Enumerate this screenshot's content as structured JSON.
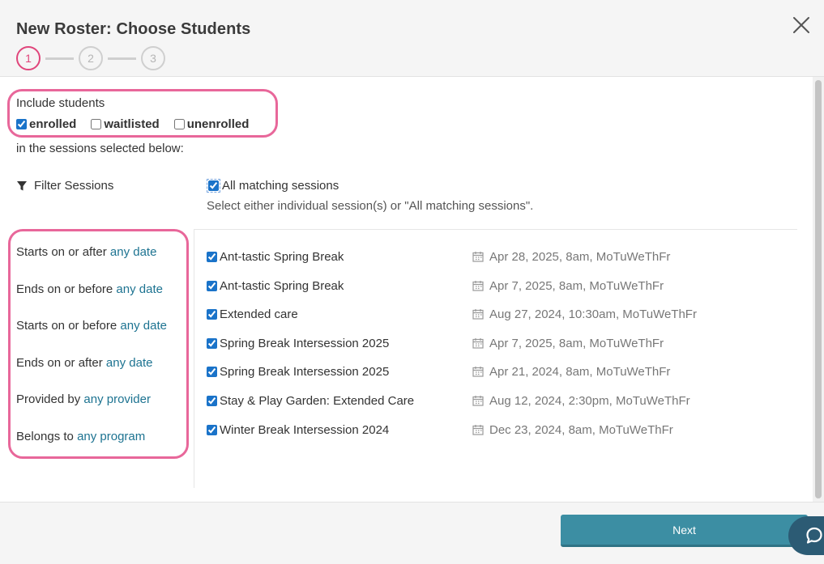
{
  "header": {
    "title": "New Roster: Choose Students",
    "steps": [
      "1",
      "2",
      "3"
    ]
  },
  "include": {
    "label": "Include students",
    "options": [
      {
        "label": "enrolled",
        "checked": true
      },
      {
        "label": "waitlisted",
        "checked": false
      },
      {
        "label": "unenrolled",
        "checked": false
      }
    ],
    "suffix": "in the sessions selected below:"
  },
  "filters": {
    "title": "Filter Sessions",
    "items": [
      {
        "prefix": "Starts on or after ",
        "link": "any date"
      },
      {
        "prefix": "Ends on or before ",
        "link": "any date"
      },
      {
        "prefix": "Starts on or before ",
        "link": "any date"
      },
      {
        "prefix": "Ends on or after ",
        "link": "any date"
      },
      {
        "prefix": "Provided by ",
        "link": "any provider"
      },
      {
        "prefix": "Belongs to ",
        "link": "any program"
      }
    ]
  },
  "sessions_panel": {
    "all_label": "All matching sessions",
    "hint": "Select either individual session(s) or \"All matching sessions\".",
    "items": [
      {
        "name": "Ant-tastic Spring Break",
        "date": "Apr 28, 2025, 8am, MoTuWeThFr"
      },
      {
        "name": "Ant-tastic Spring Break",
        "date": "Apr 7, 2025, 8am, MoTuWeThFr"
      },
      {
        "name": "Extended care",
        "date": "Aug 27, 2024, 10:30am, MoTuWeThFr"
      },
      {
        "name": "Spring Break Intersession 2025",
        "date": "Apr 7, 2025, 8am, MoTuWeThFr"
      },
      {
        "name": "Spring Break Intersession 2025",
        "date": "Apr 21, 2024, 8am, MoTuWeThFr"
      },
      {
        "name": "Stay & Play Garden: Extended Care",
        "date": "Aug 12, 2024, 2:30pm, MoTuWeThFr"
      },
      {
        "name": "Winter Break Intersession 2024",
        "date": "Dec 23, 2024, 8am, MoTuWeThFr"
      }
    ]
  },
  "footer": {
    "next_label": "Next"
  },
  "colors": {
    "accent_pink": "#e0457b",
    "link": "#1d7391",
    "button": "#3c8ea3",
    "chat": "#2c5b74"
  },
  "icons": {
    "close": "close-icon",
    "filter": "funnel-icon",
    "calendar": "calendar-icon",
    "chat": "chat-bubble-icon"
  }
}
